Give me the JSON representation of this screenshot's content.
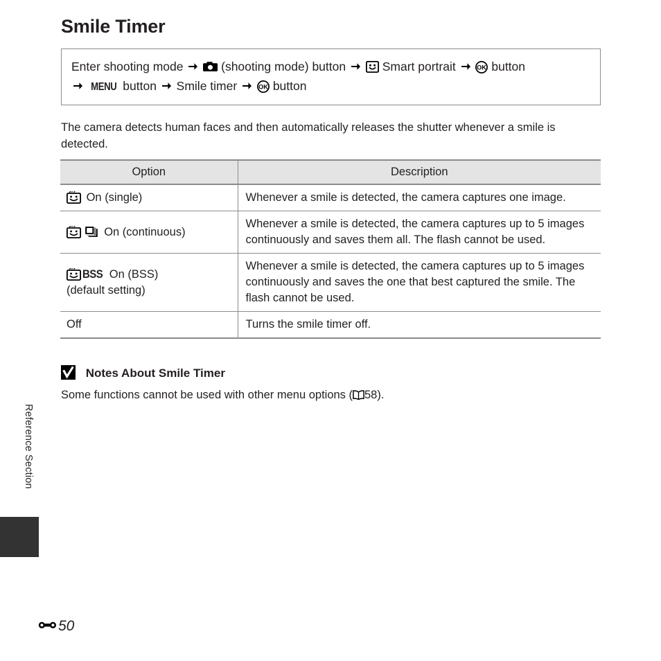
{
  "page": {
    "title": "Smile Timer",
    "side_tab_label": "Reference Section",
    "footer_page": "50",
    "footer_symbol_name": "reference-section-symbol"
  },
  "navigation": {
    "line1": {
      "text_start": "Enter shooting mode",
      "camera_icon": "camera-icon",
      "shooting_mode_label": "(shooting mode) button",
      "smart_portrait_icon": "smart-portrait-icon",
      "smart_portrait_label": "Smart portrait",
      "ok_icon": "ok-button-icon",
      "ok_label": "button"
    },
    "line2": {
      "menu_icon_label": "MENU",
      "menu_label": "button",
      "smile_timer_label": "Smile timer",
      "ok_icon": "ok-button-icon",
      "ok_label": "button"
    },
    "arrow_icon": "right-arrow-icon"
  },
  "intro": "The camera detects human faces and then automatically releases the shutter whenever a smile is detected.",
  "table": {
    "headers": {
      "option": "Option",
      "description": "Description"
    },
    "rows": [
      {
        "icons": [
          "smile-timer-icon"
        ],
        "label": "On (single)",
        "sublabel": "",
        "description": "Whenever a smile is detected, the camera captures one image."
      },
      {
        "icons": [
          "smile-timer-icon",
          "continuous-stack-icon"
        ],
        "label": "On (continuous)",
        "sublabel": "",
        "description": "Whenever a smile is detected, the camera captures up to 5 images continuously and saves them all. The flash cannot be used."
      },
      {
        "icons": [
          "smile-timer-icon",
          "bss-icon"
        ],
        "bss_text": "BSS",
        "label": "On (BSS)",
        "sublabel": "(default setting)",
        "description": "Whenever a smile is detected, the camera captures up to 5 images continuously and saves the one that best captured the smile. The flash cannot be used."
      },
      {
        "icons": [],
        "label": "Off",
        "sublabel": "",
        "description": "Turns the smile timer off."
      }
    ]
  },
  "notes": {
    "check_icon": "checkmark-badge-icon",
    "heading": "Notes About Smile Timer",
    "body_before": "Some functions cannot be used with other menu options (",
    "book_icon": "book-reference-icon",
    "body_page": "58",
    "body_after": ")."
  },
  "colors": {
    "text": "#231f20",
    "table_header_bg": "#e4e4e4",
    "rule": "#8b8b8b",
    "tab_marker": "#333333"
  }
}
